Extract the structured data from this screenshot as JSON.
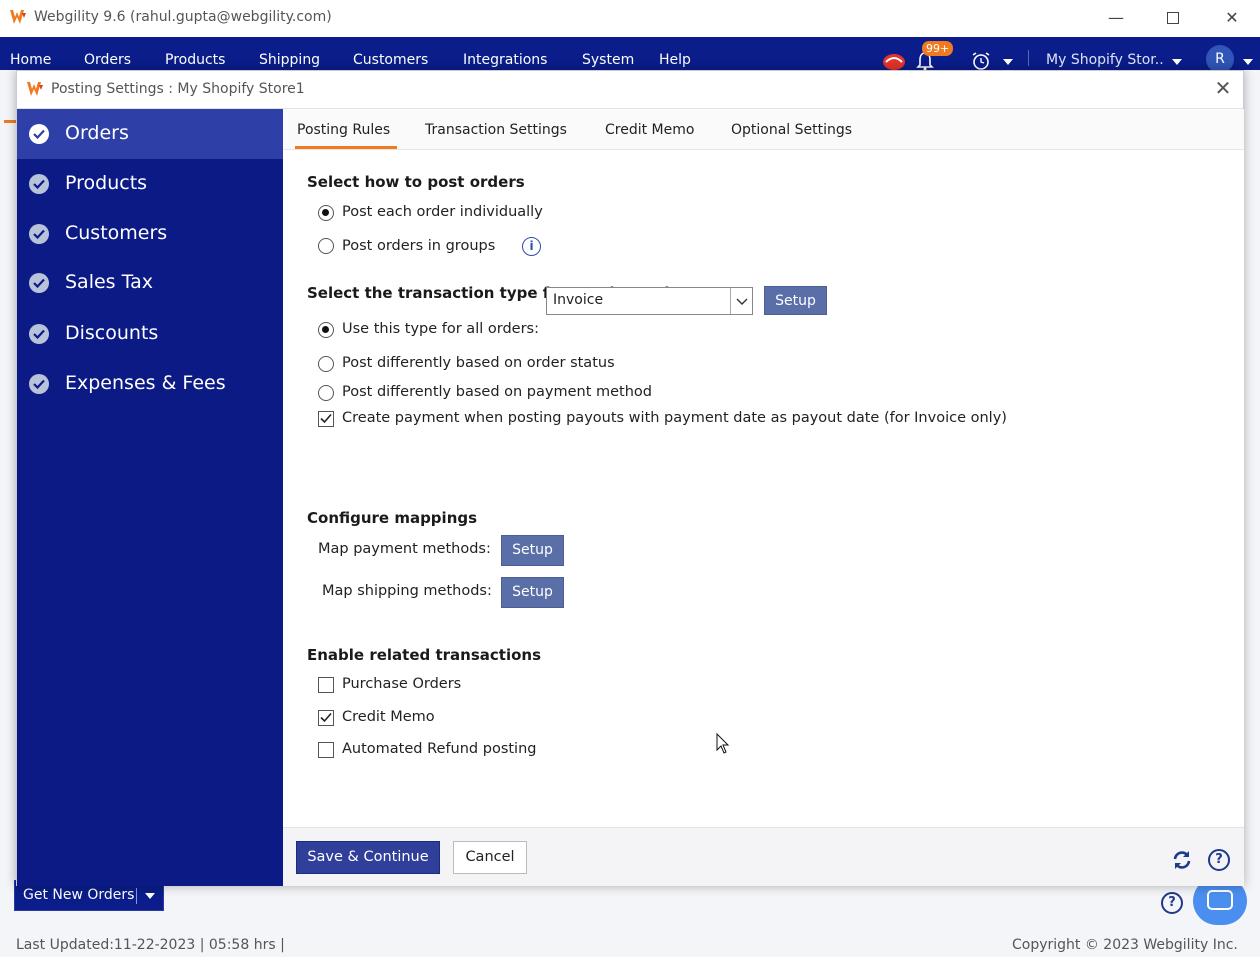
{
  "window": {
    "title": "Webgility 9.6 (rahul.gupta@webgility.com)"
  },
  "menubar": {
    "items": [
      "Home",
      "Orders",
      "Products",
      "Shipping",
      "Customers",
      "Integrations",
      "System",
      "Help"
    ],
    "notification_badge": "99+",
    "store_selector": "My Shopify Stor..",
    "avatar_initial": "R"
  },
  "dialog": {
    "title": "Posting Settings : My Shopify Store1",
    "sidebar": [
      {
        "label": "Orders",
        "active": true
      },
      {
        "label": "Products",
        "active": false
      },
      {
        "label": "Customers",
        "active": false
      },
      {
        "label": "Sales Tax",
        "active": false
      },
      {
        "label": "Discounts",
        "active": false
      },
      {
        "label": "Expenses & Fees",
        "active": false
      }
    ],
    "tabs": [
      "Posting Rules",
      "Transaction Settings",
      "Credit Memo",
      "Optional Settings"
    ],
    "active_tab": "Posting Rules",
    "post_orders": {
      "heading": "Select how to post orders",
      "options": [
        {
          "label": "Post each order individually",
          "selected": true
        },
        {
          "label": "Post orders in groups",
          "selected": false
        }
      ]
    },
    "transaction_type": {
      "heading": "Select the transaction type for posting orders",
      "use_type_label": "Use this type for all orders:",
      "type_value": "Invoice",
      "setup_label": "Setup",
      "status_label": "Post differently based on order status",
      "payment_label": "Post differently based on payment method",
      "create_payment_label": "Create payment when posting payouts with payment date as payout date (for Invoice only)",
      "create_payment_checked": true
    },
    "mappings": {
      "heading": "Configure mappings",
      "payment_label": "Map payment methods:",
      "shipping_label": "Map shipping methods:",
      "setup_label": "Setup"
    },
    "related": {
      "heading": "Enable related transactions",
      "items": [
        {
          "label": "Purchase Orders",
          "checked": false
        },
        {
          "label": "Credit Memo",
          "checked": true
        },
        {
          "label": "Automated Refund posting",
          "checked": false
        }
      ]
    },
    "footer": {
      "save_label": "Save & Continue",
      "cancel_label": "Cancel"
    }
  },
  "background": {
    "get_orders_label": "Get New Orders",
    "last_updated": "Last Updated:11-22-2023 | 05:58 hrs |",
    "copyright": "Copyright © 2023 Webgility Inc."
  },
  "colors": {
    "brand_navy": "#0c1a86",
    "accent_orange": "#f07a1f",
    "setup_button": "#5a6fa8"
  }
}
